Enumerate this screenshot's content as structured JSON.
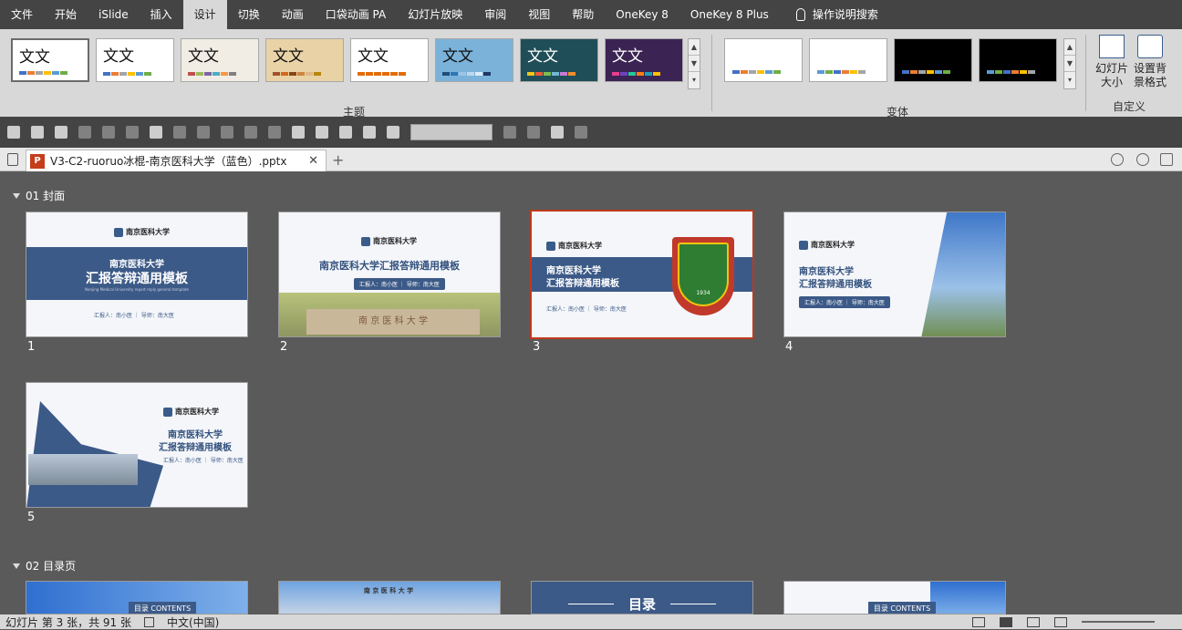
{
  "ribbon": {
    "tabs": [
      "文件",
      "开始",
      "iSlide",
      "插入",
      "设计",
      "切换",
      "动画",
      "口袋动画 PA",
      "幻灯片放映",
      "审阅",
      "视图",
      "帮助",
      "OneKey 8",
      "OneKey 8 Plus"
    ],
    "active_tab": "设计",
    "search_label": "操作说明搜索",
    "theme_sample_text": "文文",
    "themes_group_label": "主题",
    "variants_group_label": "变体",
    "custom_group_label": "自定义",
    "slide_size_label_1": "幻灯片",
    "slide_size_label_2": "大小",
    "format_bg_label_1": "设置背",
    "format_bg_label_2": "景格式"
  },
  "document": {
    "tab_title": "V3-C2-ruoruo冰棍-南京医科大学（蓝色）.pptx",
    "file_badge": "P"
  },
  "sections": [
    {
      "title": "01 封面"
    },
    {
      "title": "02 目录页"
    }
  ],
  "slides": {
    "s1": {
      "number": "1",
      "logo": "南京医科大学",
      "line1": "南京医科大学",
      "line2": "汇报答辩通用模板",
      "english": "Nanjing Medical University report reply general template",
      "footer": "汇报人：南小医  ｜  导师：南大医"
    },
    "s2": {
      "number": "2",
      "logo": "南京医科大学",
      "title": "南京医科大学汇报答辩通用模板",
      "pill": "汇报人：南小医  ｜  导师：南大医",
      "gate_text": "南 京 医 科 大 学"
    },
    "s3": {
      "number": "3",
      "logo": "南京医科大学",
      "line1": "南京医科大学",
      "line2": "汇报答辩通用模板",
      "footer": "汇报人：南小医  ｜  导师：南大医",
      "seal_year": "1934"
    },
    "s4": {
      "number": "4",
      "logo": "南京医科大学",
      "line1": "南京医科大学",
      "line2": "汇报答辩通用模板",
      "pill": "汇报人：南小医  ｜  导师：南大医"
    },
    "s5": {
      "number": "5",
      "logo": "南京医科大学",
      "line1": "南京医科大学",
      "line2": "汇报答辩通用模板",
      "footer": "汇报人：南小医  ｜  导师：南大医"
    },
    "s6": {
      "label": "目录 CONTENTS"
    },
    "s7": {
      "building_text": "南 京 医 科 大 学"
    },
    "s8": {
      "label": "目录"
    },
    "s9": {
      "label": "目录 CONTENTS"
    }
  },
  "status": {
    "slide_info": "幻灯片 第 3 张，共 91 张",
    "language": "中文(中国)"
  },
  "colors": {
    "navy": "#3c5a87",
    "selection": "#c0391b"
  }
}
